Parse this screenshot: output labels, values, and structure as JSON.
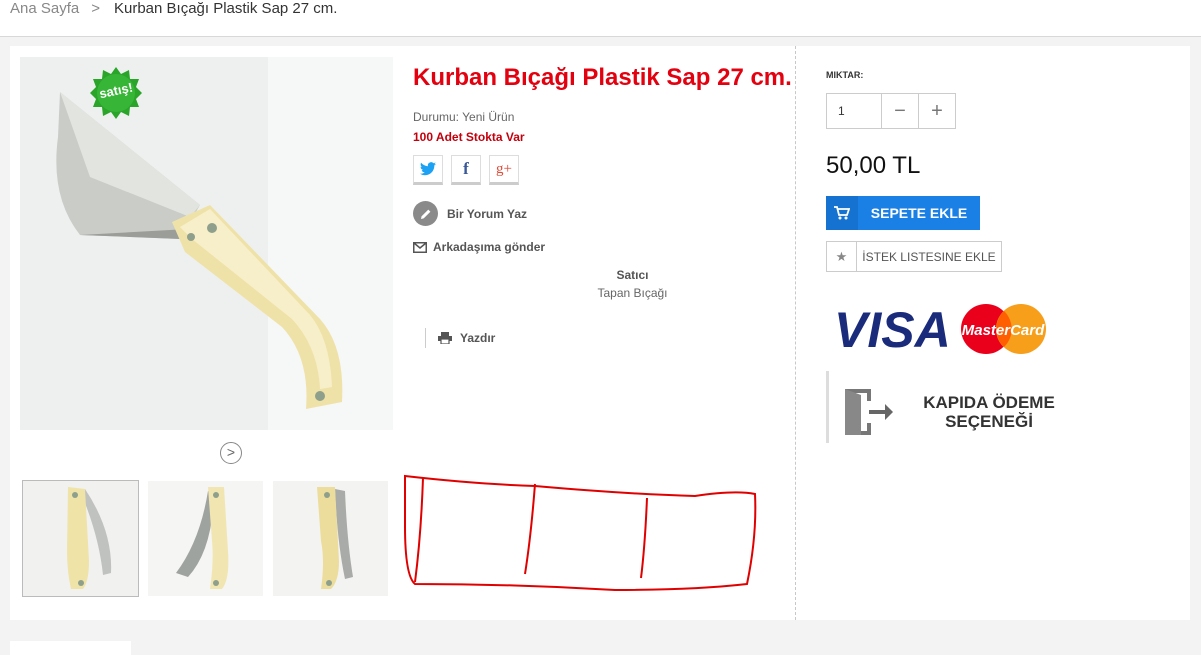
{
  "breadcrumb": {
    "home": "Ana Sayfa",
    "separator": ">",
    "current": "Kurban Bıçağı Plastik Sap 27 cm."
  },
  "product": {
    "title": "Kurban Bıçağı Plastik Sap 27 cm.",
    "badge": "satış!",
    "condition": "Durumu: Yeni Ürün",
    "stock": "100 Adet Stokta Var",
    "review_label": "Bir Yorum Yaz",
    "send_friend_label": "Arkadaşıma gönder",
    "seller_title": "Satıcı",
    "seller_name": "Tapan Bıçağı",
    "print_label": "Yazdır",
    "social": [
      "twitter-icon",
      "facebook-icon",
      "google-plus-icon"
    ],
    "social_text": {
      "facebook": "f",
      "google": "g+"
    },
    "next_glyph": ">"
  },
  "purchase": {
    "qty_label": "MIKTAR:",
    "qty_value": "1",
    "minus": "−",
    "plus": "+",
    "price": "50,00 TL",
    "cart_label": "SEPETE EKLE",
    "wish_label": "İSTEK LISTESINE EKLE",
    "wish_icon": "★"
  },
  "payment": {
    "visa_text": "VISA",
    "mastercard_text": "MasterCard",
    "cod_line1": "KAPIDA ÖDEME",
    "cod_line2": "SEÇENEĞİ"
  },
  "colors": {
    "accent_red": "#e3000f",
    "button_blue": "#1a80e6",
    "badge_green": "#2aa52a",
    "scribble_red": "#e00000"
  }
}
